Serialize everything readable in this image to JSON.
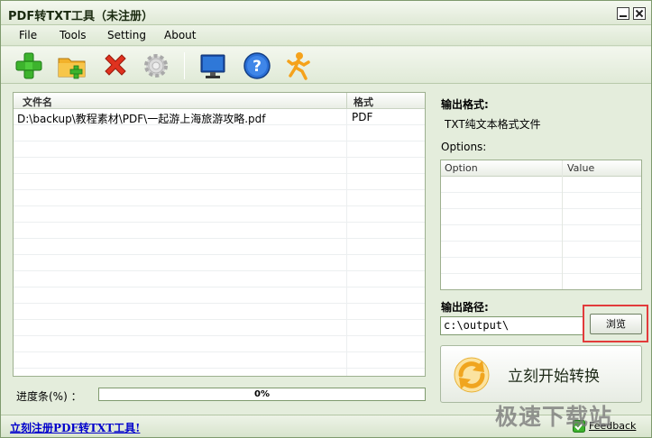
{
  "window": {
    "title": "PDF转TXT工具（未注册）"
  },
  "menu": {
    "items": [
      {
        "label": "File"
      },
      {
        "label": "Tools"
      },
      {
        "label": "Setting"
      },
      {
        "label": "About"
      }
    ]
  },
  "toolbar": {
    "buttons": [
      {
        "icon": "add-file-icon"
      },
      {
        "icon": "add-folder-icon"
      },
      {
        "icon": "delete-icon"
      },
      {
        "icon": "settings-gear-icon"
      },
      {
        "icon": "monitor-icon"
      },
      {
        "icon": "help-icon"
      },
      {
        "icon": "run-man-icon"
      }
    ]
  },
  "file_list": {
    "columns": [
      "文件名",
      "格式"
    ],
    "rows": [
      {
        "name": "D:\\backup\\教程素材\\PDF\\一起游上海旅游攻略.pdf",
        "format": "PDF"
      }
    ]
  },
  "right_panel": {
    "output_format_label": "输出格式:",
    "output_format_value": "TXT纯文本格式文件",
    "options_label": "Options:",
    "options_columns": [
      "Option",
      "Value"
    ],
    "output_path_label": "输出路径:",
    "output_path_value": "c:\\output\\",
    "browse_label": "浏览",
    "convert_label": "立刻开始转换"
  },
  "progress": {
    "label": "进度条(%) ：",
    "value": 0,
    "text": "0%"
  },
  "status": {
    "register_link": "立刻注册PDF转TXT工具!",
    "feedback": "Feedback"
  },
  "watermark": "极速下载站",
  "colors": {
    "accent_green": "#5aa34b",
    "highlight_red": "#e23b3b",
    "link_blue": "#0000cc"
  }
}
